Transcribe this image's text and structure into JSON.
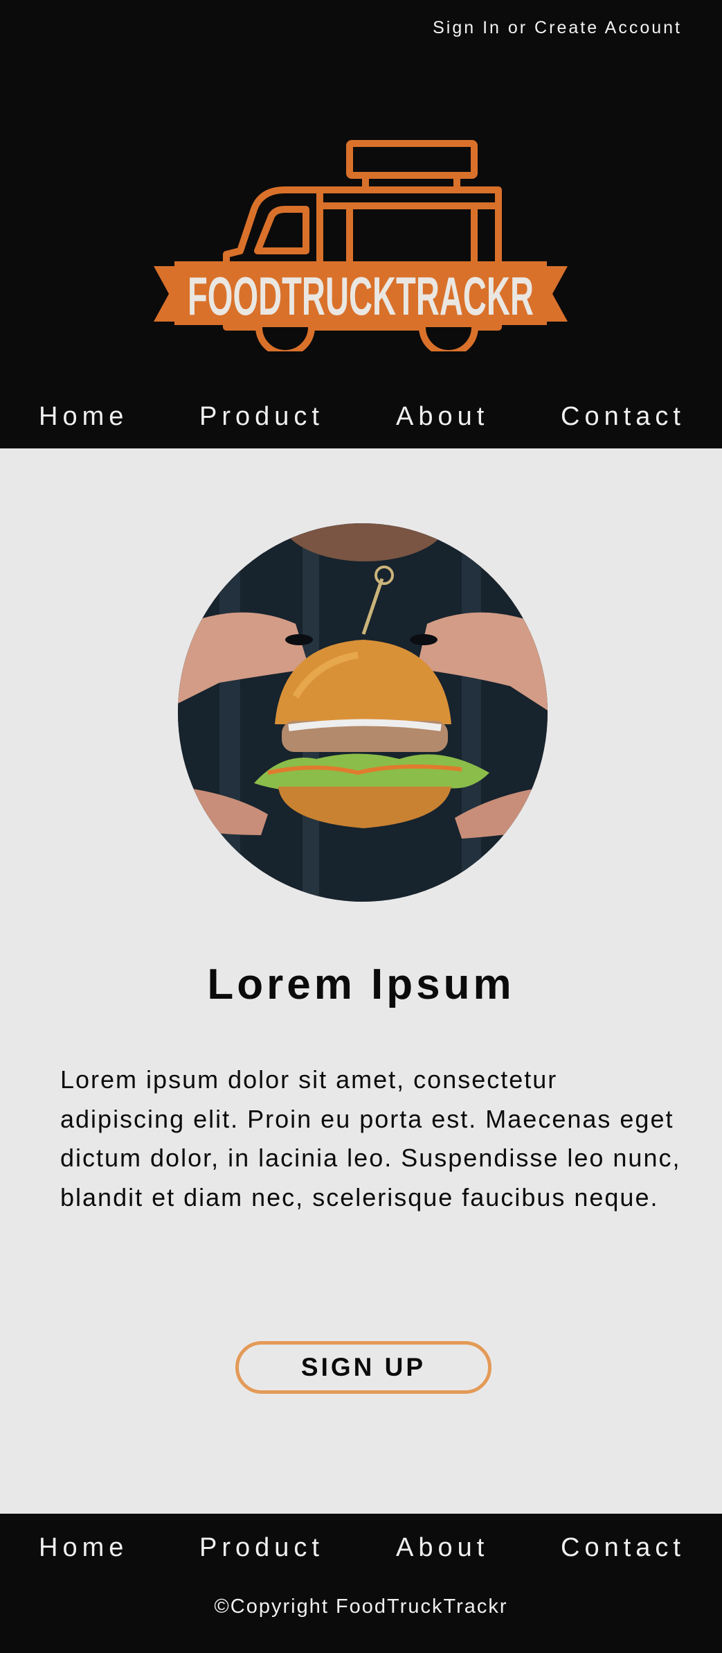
{
  "header": {
    "signin_label": "Sign In or Create Account",
    "logo_text": "FOODTRUCKTRACKR"
  },
  "nav": {
    "items": [
      {
        "label": "Home"
      },
      {
        "label": "Product"
      },
      {
        "label": "About"
      },
      {
        "label": "Contact"
      }
    ]
  },
  "main": {
    "hero_image": "burger-photo",
    "title": "Lorem Ipsum",
    "body": "Lorem ipsum dolor sit amet, consectetur adipiscing elit. Proin eu porta est. Maecenas eget dictum dolor, in lacinia leo. Suspendisse leo nunc, blandit et diam nec, scelerisque faucibus neque.",
    "signup_label": "SIGN UP"
  },
  "footer": {
    "nav": [
      {
        "label": "Home"
      },
      {
        "label": "Product"
      },
      {
        "label": "About"
      },
      {
        "label": "Contact"
      }
    ],
    "copyright": "©Copyright FoodTruckTrackr"
  },
  "colors": {
    "background": "#e9e8e8",
    "dark": "#0b0b0b",
    "brand_orange": "#d9712b",
    "button_border": "#e39a57"
  }
}
